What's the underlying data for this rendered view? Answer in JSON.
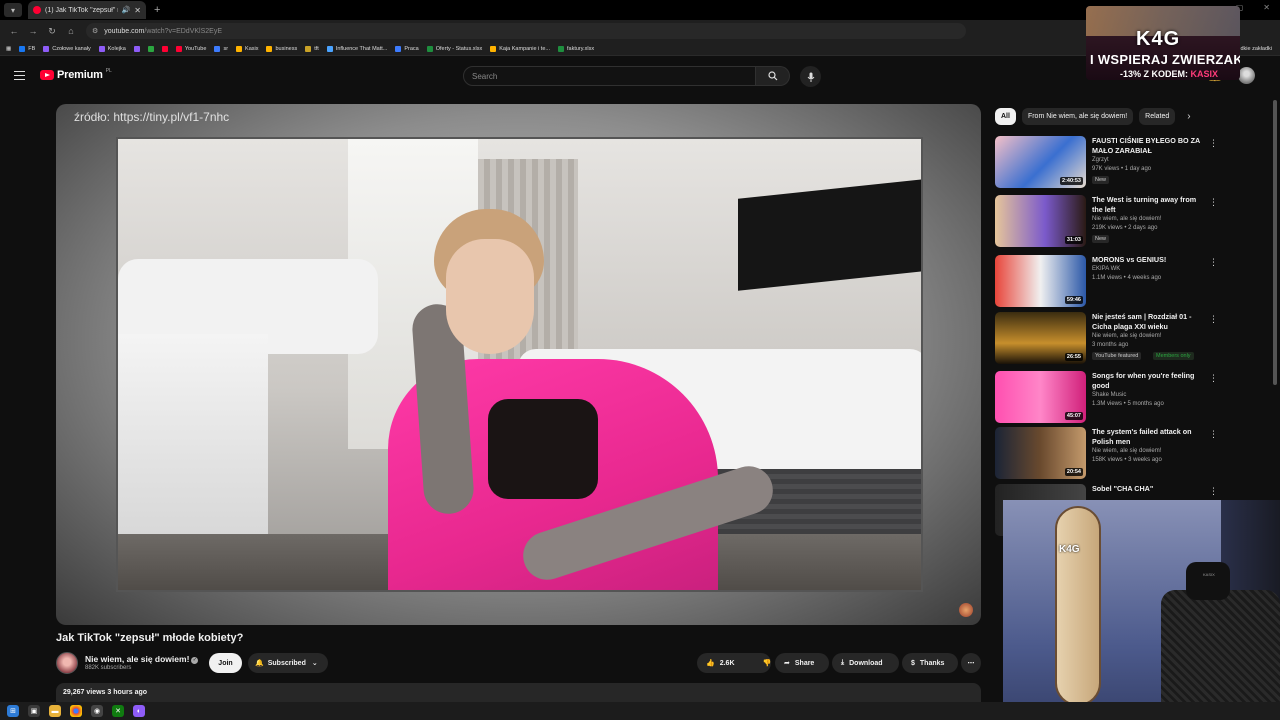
{
  "browser": {
    "tab_title": "(1) Jak TikTok \"zepsuł\" młode kobiety?",
    "url_host": "youtube.com",
    "url_path": "/watch?v=EDdVKlS2EyE",
    "bookmarks": [
      {
        "label": "FB",
        "color": "#1877f2"
      },
      {
        "label": "Czołowe kanały",
        "color": "#8e5cf7"
      },
      {
        "label": "Kolejka",
        "color": "#8e5cf7"
      },
      {
        "label": "",
        "color": "#8e5cf7"
      },
      {
        "label": "",
        "color": "#2ba640"
      },
      {
        "label": "",
        "color": "#ff0033"
      },
      {
        "label": "YouTube",
        "color": "#ff0033"
      },
      {
        "label": "sr",
        "color": "#3d7bfd"
      },
      {
        "label": "Kasix",
        "color": "#ffb300"
      },
      {
        "label": "business",
        "color": "#ffb300"
      },
      {
        "label": "tft",
        "color": "#c9a227"
      },
      {
        "label": "Influence That Matt...",
        "color": "#4aa3ff"
      },
      {
        "label": "Praca",
        "color": "#3d7bfd"
      },
      {
        "label": "Oferty - Status.xlsx",
        "color": "#1e8e3e"
      },
      {
        "label": "Kaja Kampanie i te...",
        "color": "#ffb300"
      },
      {
        "label": "faktury.xlsx",
        "color": "#1e8e3e"
      }
    ],
    "bookmarks_right": "dkie zakładki"
  },
  "promo": {
    "brand": "K4G",
    "line1": "I WSPIERAJ ZWIERZAKI",
    "line2_prefix": "-13% Z KODEM:",
    "line2_code": "KASIX"
  },
  "header": {
    "logo_text": "Premium",
    "region": "PL",
    "search_placeholder": "Search"
  },
  "player": {
    "source_overlay": "źródło: https://tiny.pl/vf1-7nhc"
  },
  "video": {
    "title": "Jak TikTok \"zepsuł\" młode kobiety?",
    "channel_name": "Nie wiem, ale się dowiem!",
    "subscribers": "882K subscribers",
    "join_label": "Join",
    "subscribed_label": "Subscribed",
    "likes": "2.6K",
    "share_label": "Share",
    "download_label": "Download",
    "thanks_label": "Thanks",
    "views_and_age": "29,267 views  3 hours ago"
  },
  "chips": [
    "All",
    "From Nie wiem, ale się dowiem!",
    "Related"
  ],
  "recommendations": [
    {
      "title": "FAUSTI CIŚNIE BYŁEGO BO ZA MAŁO ZARABIAŁ",
      "channel": "Zgrzyt",
      "meta": "97K views • 1 day ago",
      "duration": "2:40:53",
      "badge": "New",
      "badge2": "",
      "thumb": "linear-gradient(135deg,#f5c0c8,#3a6fd0 55%,#e8dccf)"
    },
    {
      "title": "The West is turning away from the left",
      "channel": "Nie wiem, ale się dowiem!",
      "meta": "219K views • 2 days ago",
      "duration": "31:03",
      "badge": "New",
      "badge2": "",
      "thumb": "linear-gradient(90deg,#e6c59a,#7b5acb 55%,#2a1a14)"
    },
    {
      "title": "MORONS vs GENIUS!",
      "channel": "EKIPA WK",
      "meta": "1.1M views • 4 weeks ago",
      "duration": "59:46",
      "badge": "",
      "badge2": "",
      "thumb": "linear-gradient(90deg,#e8453a,#f0f0f0 50%,#2b58a8)"
    },
    {
      "title": "Nie jesteś sam | Rozdział 01 - Cicha plaga XXI wieku",
      "channel": "Nie wiem, ale się dowiem!",
      "meta": "3 months ago",
      "duration": "26:55",
      "badge": "YouTube featured",
      "badge2": "Members only",
      "thumb": "linear-gradient(180deg,#3a2c10,#c78f2c 60%,#1a1208)"
    },
    {
      "title": "Songs for when you're feeling good",
      "channel": "Shake Music",
      "meta": "1.3M views • 5 months ago",
      "duration": "45:07",
      "badge": "",
      "badge2": "",
      "thumb": "linear-gradient(90deg,#ff4fb0,#ff86c8 50%,#d0207a)"
    },
    {
      "title": "The system's failed attack on Polish men",
      "channel": "Nie wiem, ale się dowiem!",
      "meta": "158K views • 3 weeks ago",
      "duration": "20:54",
      "badge": "",
      "badge2": "",
      "thumb": "linear-gradient(90deg,#1b2436,#6a4a2e 50%,#c49a6c)"
    },
    {
      "title": "Sobel \"CHA CHA\"",
      "channel": "",
      "meta": "",
      "duration": "",
      "badge": "",
      "badge2": "",
      "thumb": "linear-gradient(90deg,#222,#444)"
    }
  ],
  "webcam": {
    "brand": "K4G",
    "label": "KASIX"
  }
}
